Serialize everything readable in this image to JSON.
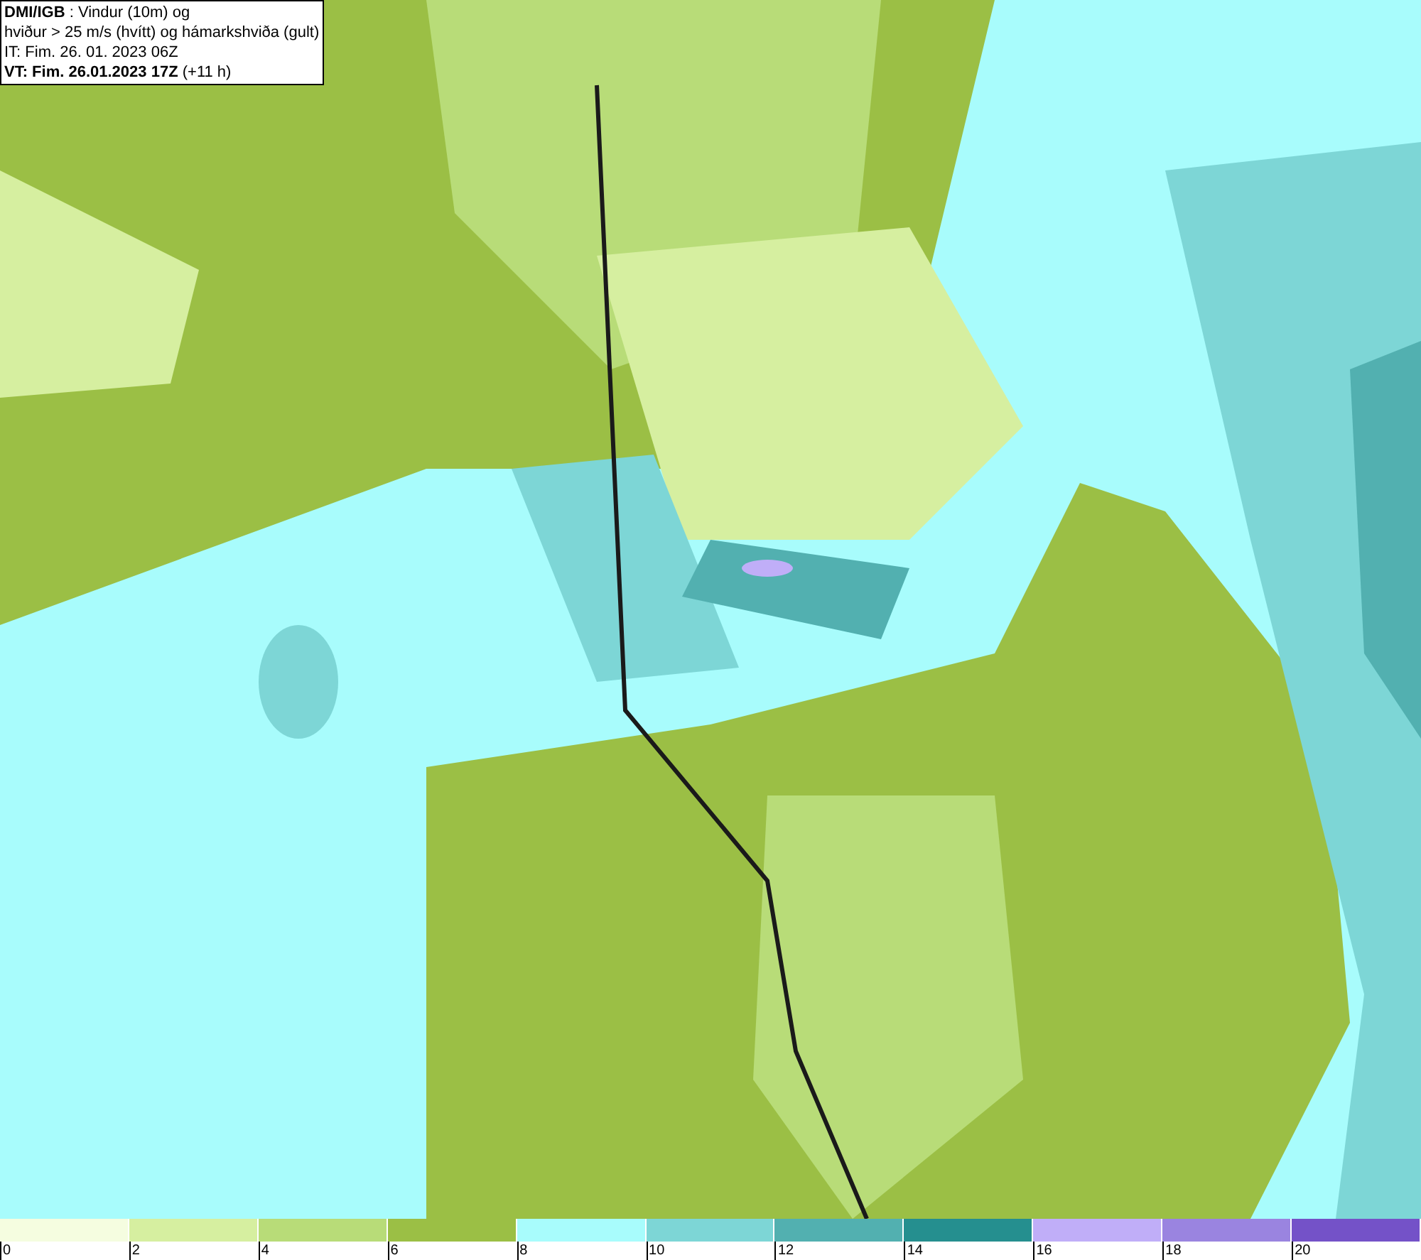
{
  "header": {
    "lines": [
      "**DMI/IGB** : Vindur (10m) og",
      "hviður > 25 m/s (hvítt) og hámarkshviða (gult)",
      "IT: Fim. 26. 01. 2023 06Z",
      "**VT: Fim. 26.01.2023 17Z** (+11 h)"
    ]
  },
  "legend": [
    {
      "label": "0",
      "color": "#f5fde0"
    },
    {
      "label": "2",
      "color": "#d6efa0"
    },
    {
      "label": "4",
      "color": "#b8dc78"
    },
    {
      "label": "6",
      "color": "#9bbf45"
    },
    {
      "label": "8",
      "color": "#a8fcfc"
    },
    {
      "label": "10",
      "color": "#7dd6d6"
    },
    {
      "label": "12",
      "color": "#52b0b0"
    },
    {
      "label": "14",
      "color": "#258f8f"
    },
    {
      "label": "16",
      "color": "#c0aef8"
    },
    {
      "label": "18",
      "color": "#9a84e0"
    },
    {
      "label": "20",
      "color": "#7452c8"
    }
  ]
}
